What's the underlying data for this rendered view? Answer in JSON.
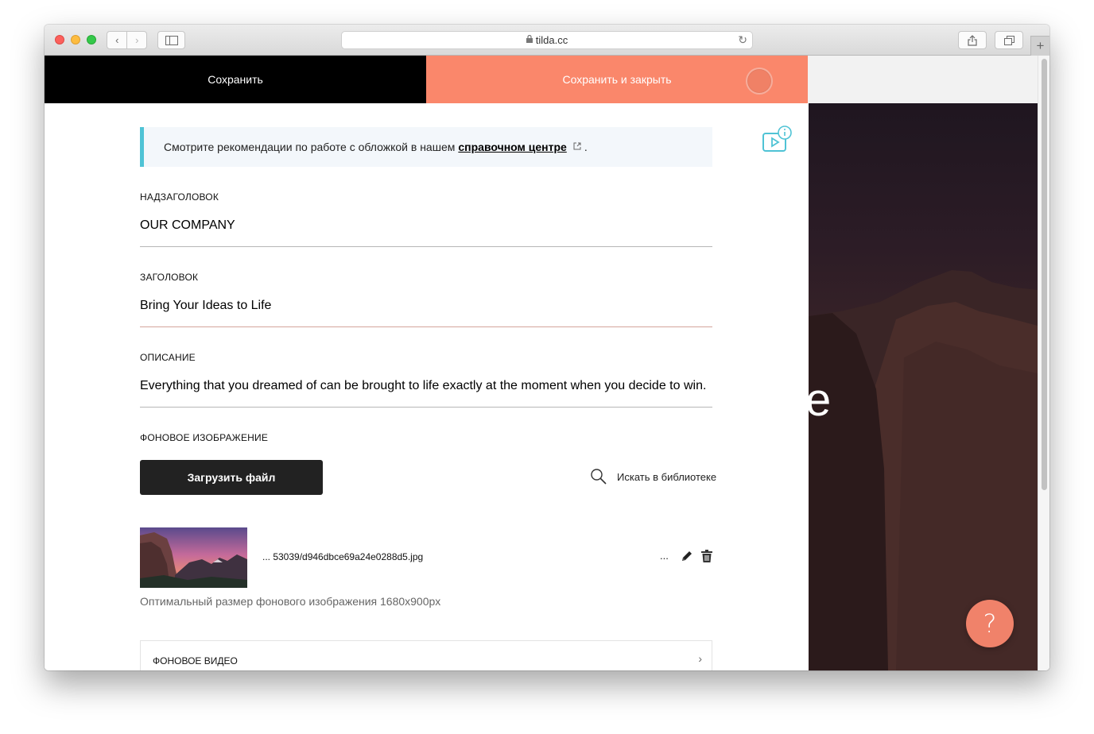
{
  "browser": {
    "url": "tilda.cc",
    "back_icon": "‹",
    "forward_icon": "›",
    "newtab_icon": "+"
  },
  "toolbar": {
    "save_label": "Сохранить",
    "save_close_label": "Сохранить и закрыть"
  },
  "notice": {
    "text": "Смотрите рекомендации по работе с обложкой в нашем",
    "link": "справочном центре",
    "suffix": "."
  },
  "fields": {
    "subtitle": {
      "label": "НАДЗАГОЛОВОК",
      "value": "OUR COMPANY"
    },
    "title": {
      "label": "ЗАГОЛОВОК",
      "value": "Bring Your Ideas to Life"
    },
    "description": {
      "label": "ОПИСАНИЕ",
      "value": "Everything that you dreamed of can be brought to life exactly at the moment when you decide to win."
    }
  },
  "background": {
    "label": "ФОНОВОЕ ИЗОБРАЖЕНИЕ",
    "upload_label": "Загрузить файл",
    "library_label": "Искать в библиотеке",
    "file_name": "... 53039/d946dbce69a24e0288d5.jpg",
    "more_label": "...",
    "hint": "Оптимальный размер фонового изображения 1680x900px"
  },
  "video": {
    "label": "ФОНОВОЕ ВИДЕО",
    "chevron": "›"
  },
  "preview": {
    "heading_fragment": "e"
  },
  "help": {
    "label": "?"
  },
  "colors": {
    "accent": "#fa876b",
    "notice_border": "#4fc3d5",
    "help_button": "#f0826a"
  },
  "icons": [
    "back-icon",
    "forward-icon",
    "sidebar-icon",
    "lock-icon",
    "reload-icon",
    "share-icon",
    "tabs-icon",
    "external-link-icon",
    "video-info-icon",
    "search-icon",
    "pencil-icon",
    "trash-icon",
    "chevron-right-icon"
  ]
}
